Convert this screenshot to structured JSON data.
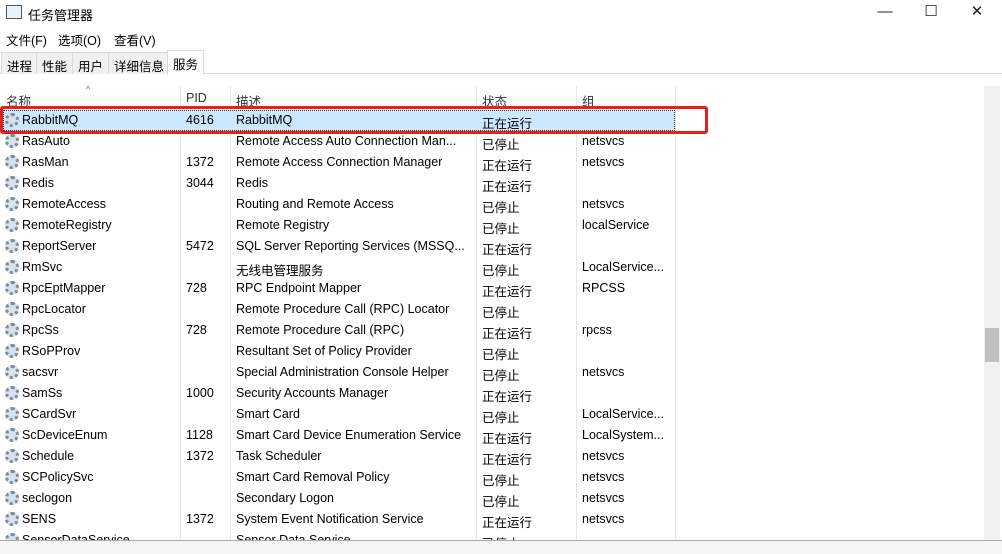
{
  "window": {
    "title": "任务管理器",
    "minimize": "—",
    "maximize": "☐",
    "close": "✕"
  },
  "menu": [
    "文件(F)",
    "选项(O)",
    "查看(V)"
  ],
  "tabs": [
    "进程",
    "性能",
    "用户",
    "详细信息",
    "服务"
  ],
  "active_tab": "服务",
  "columns": [
    "名称",
    "PID",
    "描述",
    "状态",
    "组"
  ],
  "sort": {
    "column": "名称",
    "direction": "ascending",
    "glyph": "^"
  },
  "rows": [
    {
      "name": "RabbitMQ",
      "pid": "4616",
      "desc": "RabbitMQ",
      "status": "正在运行",
      "group": "",
      "selected": true
    },
    {
      "name": "RasAuto",
      "pid": "",
      "desc": "Remote Access Auto Connection Man...",
      "status": "已停止",
      "group": "netsvcs"
    },
    {
      "name": "RasMan",
      "pid": "1372",
      "desc": "Remote Access Connection Manager",
      "status": "正在运行",
      "group": "netsvcs"
    },
    {
      "name": "Redis",
      "pid": "3044",
      "desc": "Redis",
      "status": "正在运行",
      "group": ""
    },
    {
      "name": "RemoteAccess",
      "pid": "",
      "desc": "Routing and Remote Access",
      "status": "已停止",
      "group": "netsvcs"
    },
    {
      "name": "RemoteRegistry",
      "pid": "",
      "desc": "Remote Registry",
      "status": "已停止",
      "group": "localService"
    },
    {
      "name": "ReportServer",
      "pid": "5472",
      "desc": "SQL Server Reporting Services (MSSQ...",
      "status": "正在运行",
      "group": ""
    },
    {
      "name": "RmSvc",
      "pid": "",
      "desc": "无线电管理服务",
      "status": "已停止",
      "group": "LocalService..."
    },
    {
      "name": "RpcEptMapper",
      "pid": "728",
      "desc": "RPC Endpoint Mapper",
      "status": "正在运行",
      "group": "RPCSS"
    },
    {
      "name": "RpcLocator",
      "pid": "",
      "desc": "Remote Procedure Call (RPC) Locator",
      "status": "已停止",
      "group": ""
    },
    {
      "name": "RpcSs",
      "pid": "728",
      "desc": "Remote Procedure Call (RPC)",
      "status": "正在运行",
      "group": "rpcss"
    },
    {
      "name": "RSoPProv",
      "pid": "",
      "desc": "Resultant Set of Policy Provider",
      "status": "已停止",
      "group": ""
    },
    {
      "name": "sacsvr",
      "pid": "",
      "desc": "Special Administration Console Helper",
      "status": "已停止",
      "group": "netsvcs"
    },
    {
      "name": "SamSs",
      "pid": "1000",
      "desc": "Security Accounts Manager",
      "status": "正在运行",
      "group": ""
    },
    {
      "name": "SCardSvr",
      "pid": "",
      "desc": "Smart Card",
      "status": "已停止",
      "group": "LocalService..."
    },
    {
      "name": "ScDeviceEnum",
      "pid": "1128",
      "desc": "Smart Card Device Enumeration Service",
      "status": "正在运行",
      "group": "LocalSystem..."
    },
    {
      "name": "Schedule",
      "pid": "1372",
      "desc": "Task Scheduler",
      "status": "正在运行",
      "group": "netsvcs"
    },
    {
      "name": "SCPolicySvc",
      "pid": "",
      "desc": "Smart Card Removal Policy",
      "status": "已停止",
      "group": "netsvcs"
    },
    {
      "name": "seclogon",
      "pid": "",
      "desc": "Secondary Logon",
      "status": "已停止",
      "group": "netsvcs"
    },
    {
      "name": "SENS",
      "pid": "1372",
      "desc": "System Event Notification Service",
      "status": "正在运行",
      "group": "netsvcs"
    },
    {
      "name": "SensorDataService",
      "pid": "",
      "desc": "Sensor Data Service",
      "status": "已停止",
      "group": ""
    }
  ],
  "colors": {
    "selection": "#cce8ff",
    "highlight_box": "#e8201c"
  }
}
